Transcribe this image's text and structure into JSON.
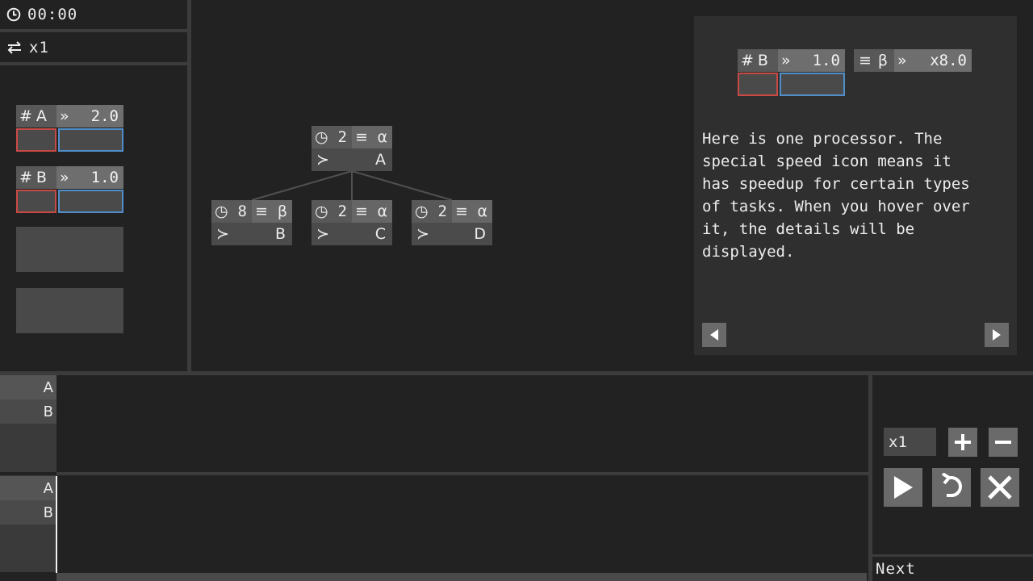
{
  "status": {
    "time": "00:00",
    "speed": "x1"
  },
  "processors": [
    {
      "id": "A",
      "speed": "2.0"
    },
    {
      "id": "B",
      "speed": "1.0"
    }
  ],
  "tasks": {
    "root": {
      "duration": "2",
      "type": "α",
      "name": "A"
    },
    "children": [
      {
        "duration": "8",
        "type": "β",
        "name": "B"
      },
      {
        "duration": "2",
        "type": "α",
        "name": "C"
      },
      {
        "duration": "2",
        "type": "α",
        "name": "D"
      }
    ]
  },
  "tutorial": {
    "processor": {
      "id": "B",
      "speed": "1.0",
      "special_type": "β",
      "special_speed": "x8.0"
    },
    "text": "Here is one processor. The\nspecial speed icon means it\nhas speedup for certain types\nof tasks. When you hover over\nit, the details will be\ndisplayed."
  },
  "timeline": {
    "upper_rows": [
      "A",
      "B"
    ],
    "lower_rows": [
      "A",
      "B"
    ]
  },
  "controls": {
    "speed_value": "x1",
    "next_label": "Next"
  },
  "colors": {
    "background": "#222222",
    "red_bar": "#c84a45",
    "blue_bar": "#4f8ec9"
  }
}
